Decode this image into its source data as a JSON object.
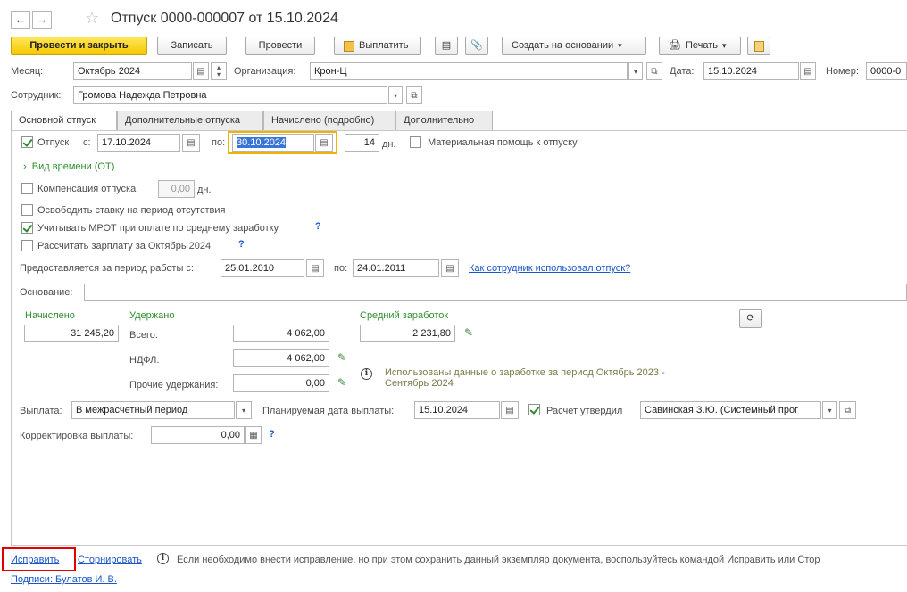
{
  "window": {
    "title": "Отпуск 0000-000007 от 15.10.2024"
  },
  "toolbar": {
    "post_close": "Провести и закрыть",
    "save": "Записать",
    "post": "Провести",
    "pay": "Выплатить",
    "create_based": "Создать на основании",
    "print": "Печать"
  },
  "header": {
    "month_label": "Месяц:",
    "month_value": "Октябрь 2024",
    "org_label": "Организация:",
    "org_value": "Крон-Ц",
    "date_label": "Дата:",
    "date_value": "15.10.2024",
    "number_label": "Номер:",
    "number_value": "0000-0",
    "employee_label": "Сотрудник:",
    "employee_value": "Громова Надежда Петровна"
  },
  "tabs": [
    {
      "label": "Основной отпуск"
    },
    {
      "label": "Дополнительные отпуска"
    },
    {
      "label": "Начислено (подробно)"
    },
    {
      "label": "Дополнительно"
    }
  ],
  "main": {
    "vacation_check_label": "Отпуск",
    "from_label": "с:",
    "from_value": "17.10.2024",
    "to_label": "по:",
    "to_value": "30.10.2024",
    "days_value": "14",
    "days_unit": "дн.",
    "financial_aid_label": "Материальная помощь к отпуску",
    "time_type_label": "Вид времени (ОТ)",
    "compensation_label": "Компенсация отпуска",
    "compensation_value": "0,00",
    "compensation_unit": "дн.",
    "release_rate_label": "Освободить ставку на период отсутствия",
    "mrot_label": "Учитывать МРОТ при оплате по среднему заработку",
    "calc_salary_label": "Рассчитать зарплату за Октябрь 2024",
    "period_label": "Предоставляется за период работы с:",
    "period_from": "25.01.2010",
    "period_to_label": "по:",
    "period_to": "24.01.2011",
    "usage_link": "Как сотрудник использовал отпуск?",
    "basis_label": "Основание:",
    "basis_value": ""
  },
  "totals": {
    "accrued_title": "Начислено",
    "accrued_value": "31 245,20",
    "withheld_title": "Удержано",
    "total_label": "Всего:",
    "total_value": "4 062,00",
    "ndfl_label": "НДФЛ:",
    "ndfl_value": "4 062,00",
    "other_label": "Прочие удержания:",
    "other_value": "0,00",
    "avg_title": "Средний заработок",
    "avg_value": "2 231,80",
    "info_line1": "Использованы данные о заработке за период Октябрь 2023 -",
    "info_line2": "Сентябрь 2024"
  },
  "payment": {
    "payout_label": "Выплата:",
    "payout_value": "В межрасчетный период",
    "planned_date_label": "Планируемая дата выплаты:",
    "planned_date_value": "15.10.2024",
    "approved_label": "Расчет утвердил",
    "approved_value": "Савинская З.Ю. (Системный прог",
    "correction_label": "Корректировка выплаты:",
    "correction_value": "0,00"
  },
  "footer": {
    "fix_link": "Исправить",
    "storno_link": "Сторнировать",
    "hint": "Если необходимо внести исправление, но при этом сохранить данный экземпляр документа, воспользуйтесь командой Исправить или Стор",
    "signatures": "Подписи: Булатов И. В."
  },
  "colors": {
    "accent_yellow": "#f5c800",
    "link_blue": "#1a56c8",
    "green": "#2f8f2f",
    "focus_orange": "#f0b400",
    "highlight_red": "#e00000"
  }
}
